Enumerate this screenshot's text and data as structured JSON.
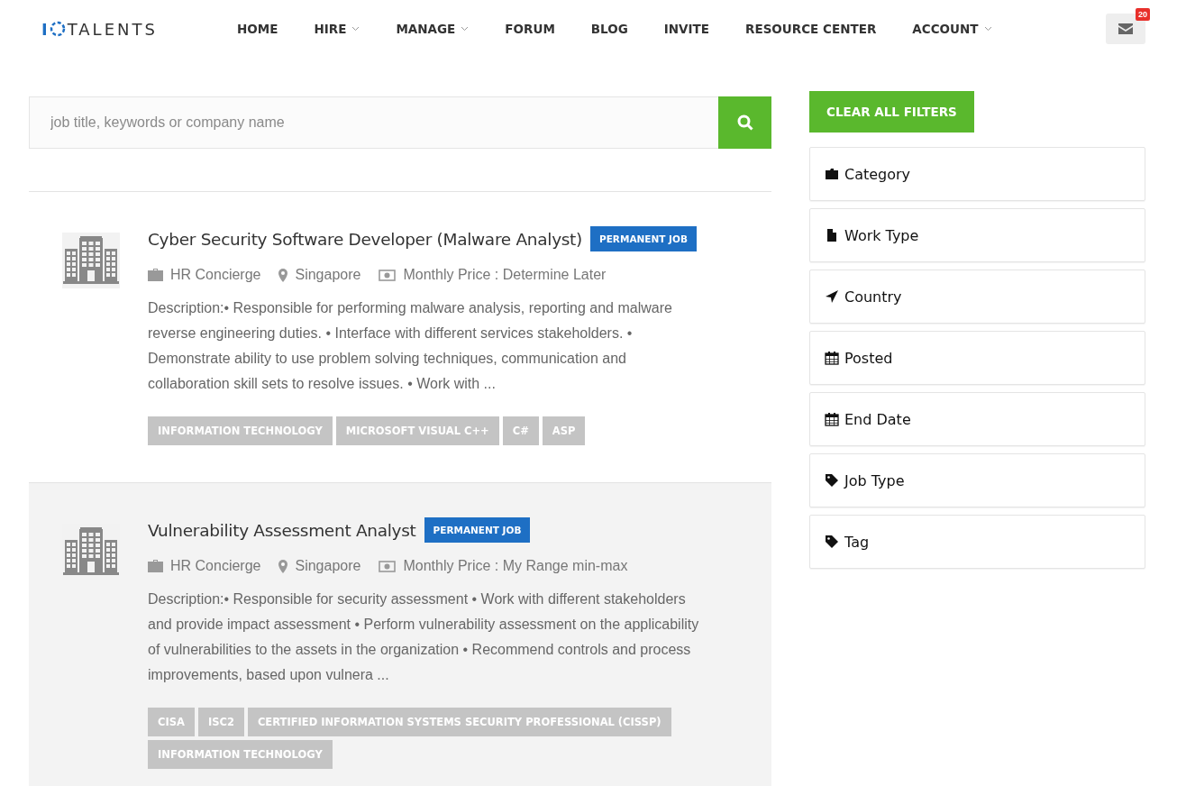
{
  "logo": {
    "prefix": "I",
    "suffix": "TALENTS"
  },
  "nav": [
    {
      "label": "HOME",
      "dropdown": false
    },
    {
      "label": "HIRE",
      "dropdown": true
    },
    {
      "label": "MANAGE",
      "dropdown": true
    },
    {
      "label": "FORUM",
      "dropdown": false
    },
    {
      "label": "BLOG",
      "dropdown": false
    },
    {
      "label": "INVITE",
      "dropdown": false
    },
    {
      "label": "RESOURCE CENTER",
      "dropdown": false
    },
    {
      "label": "ACCOUNT",
      "dropdown": true
    }
  ],
  "messages": {
    "count": "20"
  },
  "search": {
    "placeholder": "job title, keywords or company name"
  },
  "jobs": [
    {
      "title": "Cyber Security Software Developer (Malware Analyst)",
      "badge": "PERMANENT JOB",
      "highlighted": false,
      "company": "HR Concierge",
      "location": "Singapore",
      "price": "Monthly Price : Determine Later",
      "description": "Description:• Responsible for performing malware analysis, reporting and malware reverse engineering duties. • Interface with different services stakeholders. • Demonstrate ability to use problem solving techniques, communication and collaboration skill sets to resolve issues. • Work with ...",
      "tags": [
        "INFORMATION TECHNOLOGY",
        "MICROSOFT VISUAL C++",
        "C#",
        "ASP"
      ]
    },
    {
      "title": "Vulnerability Assessment Analyst",
      "badge": "PERMANENT JOB",
      "highlighted": true,
      "company": "HR Concierge",
      "location": "Singapore",
      "price": "Monthly Price : My Range min-max",
      "description": "Description:• Responsible for security assessment • Work with different stakeholders and provide impact assessment • Perform vulnerability assessment on the applicability of vulnerabilities to the assets in the organization • Recommend controls and process improvements, based upon vulnera ...",
      "tags": [
        "CISA",
        "ISC2",
        "CERTIFIED INFORMATION SYSTEMS SECURITY PROFESSIONAL (CISSP)",
        "INFORMATION TECHNOLOGY"
      ]
    }
  ],
  "clear_button": "CLEAR ALL FILTERS",
  "filters": [
    {
      "label": "Category",
      "kind": "folder"
    },
    {
      "label": "Work Type",
      "kind": "file"
    },
    {
      "label": "Country",
      "kind": "location"
    },
    {
      "label": "Posted",
      "kind": "calendar"
    },
    {
      "label": "End Date",
      "kind": "calendar"
    },
    {
      "label": "Job Type",
      "kind": "tag"
    },
    {
      "label": "Tag",
      "kind": "tag"
    }
  ]
}
